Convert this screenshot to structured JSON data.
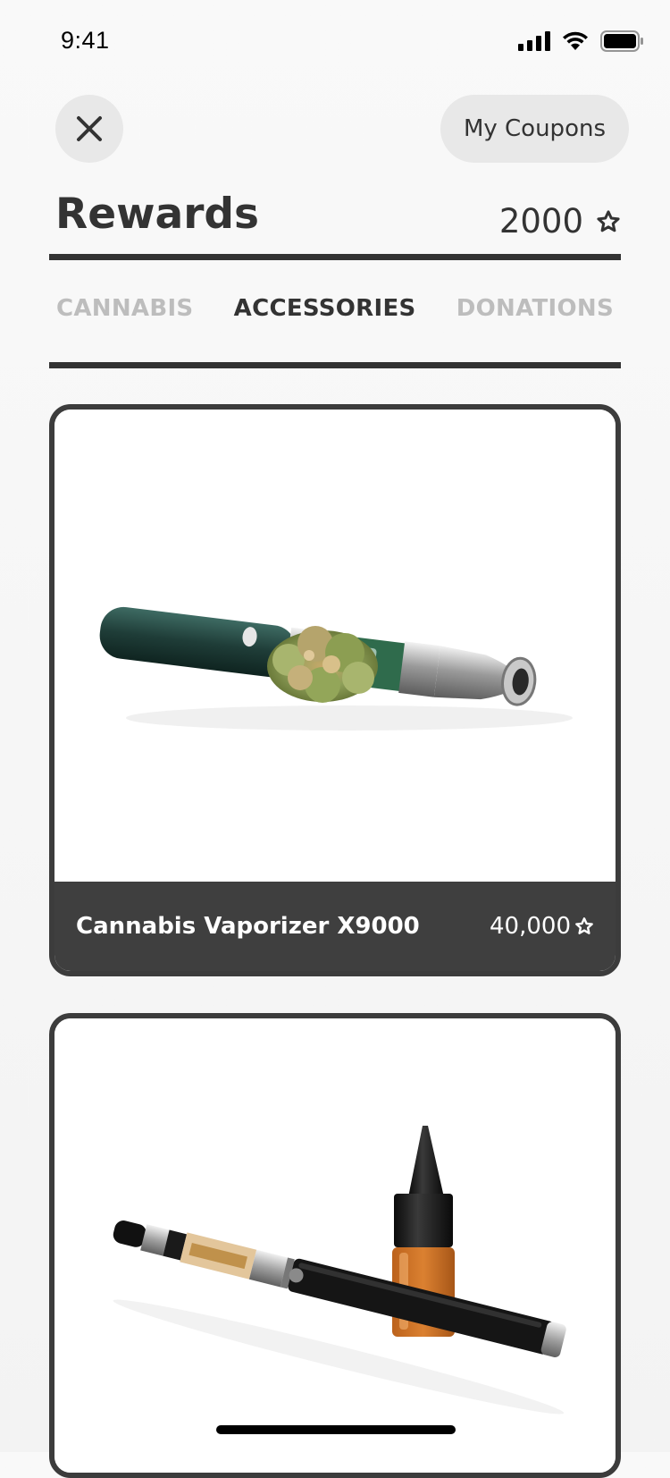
{
  "status_bar": {
    "time": "9:41"
  },
  "header": {
    "close_icon": "close-icon",
    "coupons_label": "My Coupons"
  },
  "title_row": {
    "title": "Rewards",
    "points": "2000",
    "points_icon": "star-outline-icon"
  },
  "tabs": [
    {
      "label": "CANNABIS",
      "active": false
    },
    {
      "label": "ACCESSORIES",
      "active": true
    },
    {
      "label": "DONATIONS",
      "active": false
    }
  ],
  "rewards": [
    {
      "name": "Cannabis Vaporizer X9000",
      "price": "40,000",
      "image": "vape-pen-with-cannabis-bud"
    },
    {
      "name": "",
      "price": "",
      "image": "e-cigarette-with-oil-bottle"
    }
  ],
  "colors": {
    "dark": "#333333",
    "card_border": "#3c3c3c",
    "card_footer": "#3f3f3f",
    "button_bg": "#e8e8e8",
    "tab_inactive": "#bdbdbd"
  }
}
